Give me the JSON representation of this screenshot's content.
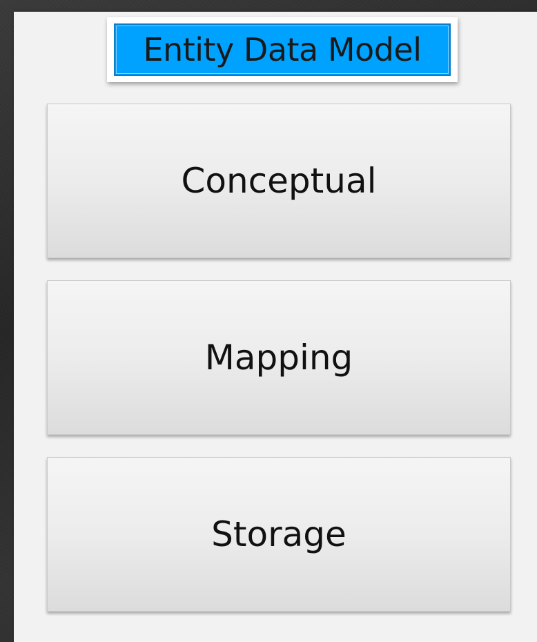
{
  "diagram": {
    "title": "Entity Data Model",
    "layers": [
      {
        "label": "Conceptual"
      },
      {
        "label": "Mapping"
      },
      {
        "label": "Storage"
      }
    ]
  },
  "colors": {
    "title_fill": "#00a2ff",
    "title_border": "#0a7fc9",
    "panel_background": "#f2f2f2",
    "layer_fill": "#ececec"
  }
}
